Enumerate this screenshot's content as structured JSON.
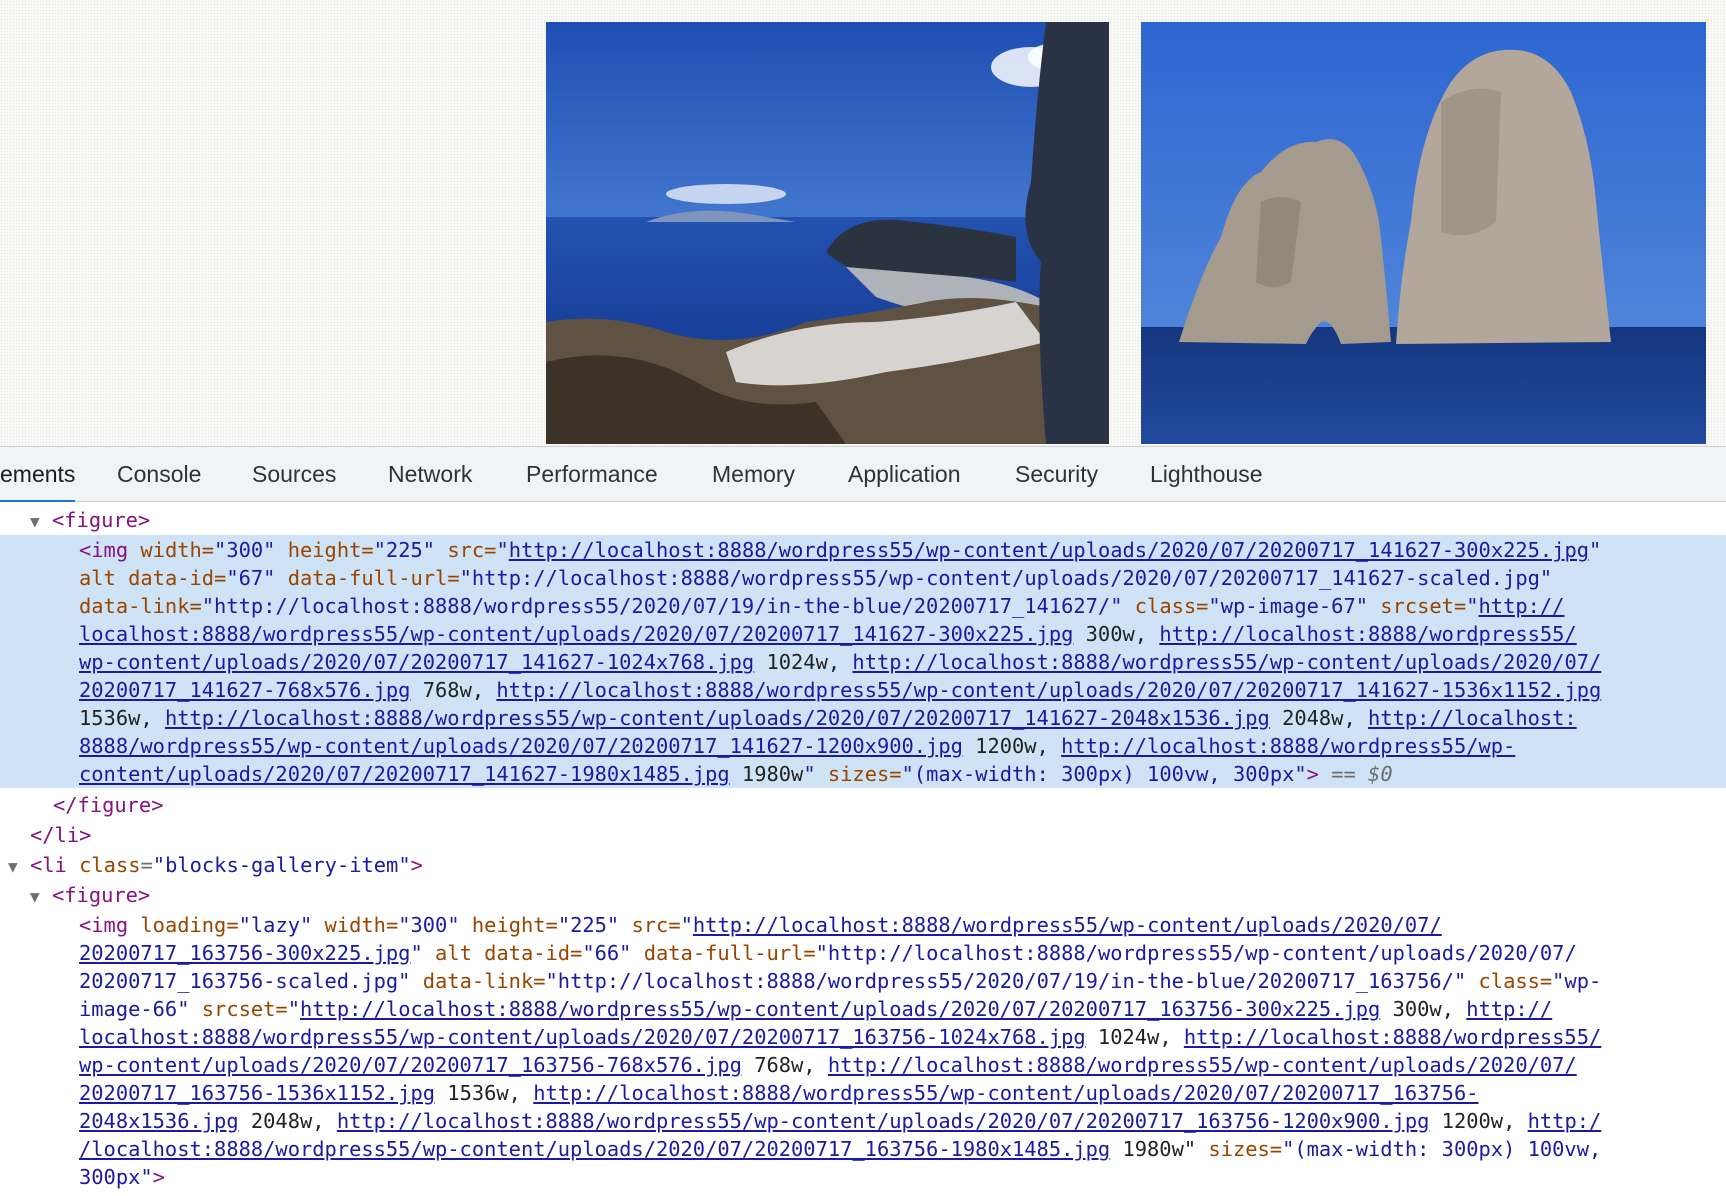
{
  "devtools": {
    "tabs": [
      "ements",
      "Console",
      "Sources",
      "Network",
      "Performance",
      "Memory",
      "Application",
      "Security",
      "Lighthouse"
    ],
    "active_tab": "ements"
  },
  "dom": {
    "figure_open": "<figure>",
    "figure_close": "</figure>",
    "li_close": "</li>",
    "li_open_tag": "<li",
    "li_class_attr": "class",
    "li_class_val": "blocks-gallery-item",
    "img1": {
      "l1": [
        "<img",
        " width=",
        "\"300\"",
        " height=",
        "\"225\"",
        " src=",
        "\"",
        "http://localhost:8888/wordpress55/wp-content/uploads/2020/07/20200717_141627-300x225.jpg",
        "\""
      ],
      "l2": [
        "alt",
        " data-id=",
        "\"67\"",
        " data-full-url=",
        "\"http://localhost:8888/wordpress55/wp-content/uploads/2020/07/20200717_141627-scaled.jpg\""
      ],
      "l3": [
        "data-link=",
        "\"http://localhost:8888/wordpress55/2020/07/19/in-the-blue/20200717_141627/\"",
        " class=",
        "\"wp-image-67\"",
        " srcset=",
        "\"",
        "http://"
      ],
      "l4": [
        "localhost:8888/wordpress55/wp-content/uploads/2020/07/20200717_141627-300x225.jpg",
        " 300w, ",
        "http://localhost:8888/wordpress55/"
      ],
      "l5": [
        "wp-content/uploads/2020/07/20200717_141627-1024x768.jpg",
        " 1024w, ",
        "http://localhost:8888/wordpress55/wp-content/uploads/2020/07/"
      ],
      "l6": [
        "20200717_141627-768x576.jpg",
        " 768w, ",
        "http://localhost:8888/wordpress55/wp-content/uploads/2020/07/20200717_141627-1536x1152.jpg"
      ],
      "l7": [
        "1536w, ",
        "http://localhost:8888/wordpress55/wp-content/uploads/2020/07/20200717_141627-2048x1536.jpg",
        " 2048w, ",
        "http://localhost:"
      ],
      "l8": [
        "8888/wordpress55/wp-content/uploads/2020/07/20200717_141627-1200x900.jpg",
        " 1200w, ",
        "http://localhost:8888/wordpress55/wp-"
      ],
      "l9": [
        "content/uploads/2020/07/20200717_141627-1980x1485.jpg",
        " 1980w",
        "\"",
        " sizes=",
        "\"(max-width: 300px) 100vw, 300px\"",
        ">",
        " == ",
        "$0"
      ]
    },
    "img2": {
      "l1": [
        "<img",
        " loading=",
        "\"lazy\"",
        " width=",
        "\"300\"",
        " height=",
        "\"225\"",
        " src=",
        "\"",
        "http://localhost:8888/wordpress55/wp-content/uploads/2020/07/"
      ],
      "l2": [
        "20200717_163756-300x225.jpg",
        "\"",
        " alt data-id=",
        "\"66\"",
        " data-full-url=",
        "\"http://localhost:8888/wordpress55/wp-content/uploads/2020/07/"
      ],
      "l3": [
        "20200717_163756-scaled.jpg\"",
        " data-link=",
        "\"http://localhost:8888/wordpress55/2020/07/19/in-the-blue/20200717_163756/\"",
        " class=",
        "\"wp-"
      ],
      "l4": [
        "image-66\"",
        " srcset=",
        "\"",
        "http://localhost:8888/wordpress55/wp-content/uploads/2020/07/20200717_163756-300x225.jpg",
        " 300w, ",
        "http://"
      ],
      "l5": [
        "localhost:8888/wordpress55/wp-content/uploads/2020/07/20200717_163756-1024x768.jpg",
        " 1024w, ",
        "http://localhost:8888/wordpress55/"
      ],
      "l6": [
        "wp-content/uploads/2020/07/20200717_163756-768x576.jpg",
        " 768w, ",
        "http://localhost:8888/wordpress55/wp-content/uploads/2020/07/"
      ],
      "l7": [
        "20200717_163756-1536x1152.jpg",
        " 1536w, ",
        "http://localhost:8888/wordpress55/wp-content/uploads/2020/07/20200717_163756-"
      ],
      "l8": [
        "2048x1536.jpg",
        " 2048w, ",
        "http://localhost:8888/wordpress55/wp-content/uploads/2020/07/20200717_163756-1200x900.jpg",
        " 1200w, ",
        "http:/"
      ],
      "l9": [
        "/localhost:8888/wordpress55/wp-content/uploads/2020/07/20200717_163756-1980x1485.jpg",
        " 1980w\"",
        " sizes=",
        "\"(max-width: 300px) 100vw,"
      ],
      "l10": [
        "300px\"",
        ">"
      ]
    }
  }
}
